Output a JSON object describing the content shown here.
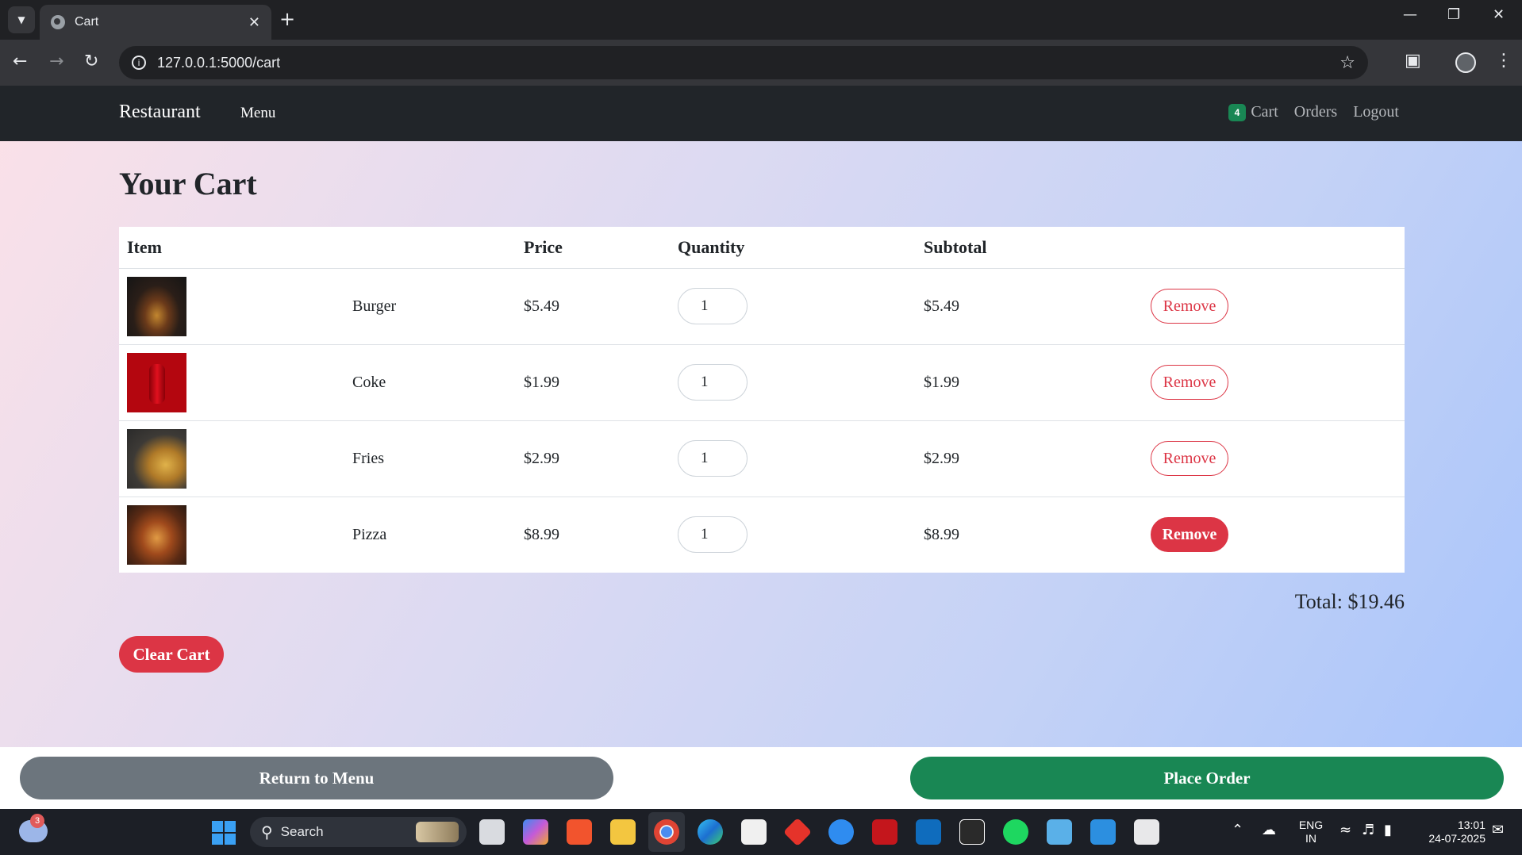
{
  "browser": {
    "tab_title": "Cart",
    "url": "127.0.0.1:5000/cart",
    "icons": [
      "tab-search-icon",
      "globe-icon",
      "close-icon",
      "new-tab-icon",
      "minimize-icon",
      "restore-icon",
      "window-close-icon",
      "back-icon",
      "forward-icon",
      "reload-icon",
      "info-icon",
      "star-icon",
      "extensions-icon",
      "profile-avatar",
      "more-icon"
    ]
  },
  "navbar": {
    "brand": "Restaurant",
    "menu_link": "Menu",
    "cart_count": "4",
    "cart_link": "Cart",
    "orders_link": "Orders",
    "logout_link": "Logout"
  },
  "page": {
    "title": "Your Cart"
  },
  "table": {
    "headers": {
      "item": "Item",
      "price": "Price",
      "quantity": "Quantity",
      "subtotal": "Subtotal"
    },
    "rows": [
      {
        "image": "burger-image",
        "name": "Burger",
        "price": "$5.49",
        "quantity": "1",
        "subtotal": "$5.49",
        "action": "Remove",
        "action_style": "outline"
      },
      {
        "image": "coke-image",
        "name": "Coke",
        "price": "$1.99",
        "quantity": "1",
        "subtotal": "$1.99",
        "action": "Remove",
        "action_style": "outline"
      },
      {
        "image": "fries-image",
        "name": "Fries",
        "price": "$2.99",
        "quantity": "1",
        "subtotal": "$2.99",
        "action": "Remove",
        "action_style": "outline"
      },
      {
        "image": "pizza-image",
        "name": "Pizza",
        "price": "$8.99",
        "quantity": "1",
        "subtotal": "$8.99",
        "action": "Remove",
        "action_style": "filled (hovered)"
      }
    ]
  },
  "summary": {
    "total": "Total: $19.46"
  },
  "actions": {
    "clear_cart": "Clear Cart",
    "return_to_menu": "Return to Menu",
    "place_order": "Place Order"
  },
  "colors": {
    "navbar_bg": "#212529",
    "badge_green": "#198754",
    "danger_red": "#dc3545",
    "secondary_gray": "#6c757d",
    "success_green": "#198754",
    "page_gradient_start": "#fbe1e8",
    "page_gradient_end": "#a8c4fb"
  },
  "taskbar": {
    "weather_badge": "3",
    "search_label": "Search",
    "apps": [
      "file-explorer-icon",
      "copilot-icon",
      "brave-icon",
      "folder-icon",
      "chrome-icon",
      "edge-icon",
      "store-icon",
      "git-icon",
      "help-icon",
      "mcafee-icon",
      "outlook-icon",
      "epic-games-icon",
      "spotify-icon",
      "notepad-icon",
      "vscode-icon",
      "snipping-tool-icon"
    ],
    "lang_line1": "ENG",
    "lang_line2": "IN",
    "time": "13:01",
    "date": "24-07-2025"
  }
}
